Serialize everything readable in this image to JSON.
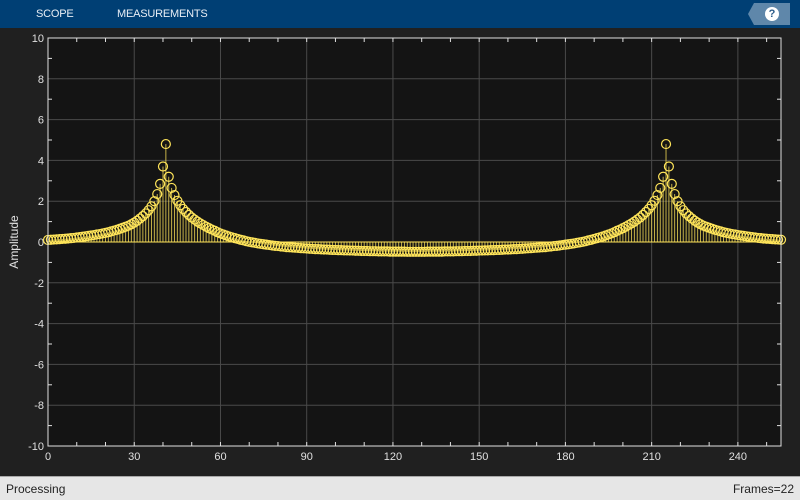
{
  "toolbar": {
    "tabs": [
      "SCOPE",
      "MEASUREMENTS"
    ],
    "help_label": "?"
  },
  "status": {
    "left": "Processing",
    "right": "Frames=22"
  },
  "colors": {
    "toolbar": "#003f74",
    "axes_bg": "#141414",
    "figure_bg": "#202020",
    "series": "#ffe55a",
    "grid": "#4a4a4a"
  },
  "chart_data": {
    "type": "stem",
    "title": "",
    "xlabel": "",
    "ylabel": "Amplitude",
    "xlim": [
      0,
      255
    ],
    "ylim": [
      -10,
      10
    ],
    "grid": true,
    "xticks": [
      0,
      30,
      60,
      90,
      120,
      150,
      180,
      210,
      240
    ],
    "yticks": [
      -10,
      -8,
      -6,
      -4,
      -2,
      0,
      2,
      4,
      6,
      8,
      10
    ],
    "x_start": 0,
    "x_step": 1,
    "values": [
      0.1,
      0.11,
      0.12,
      0.13,
      0.14,
      0.15,
      0.16,
      0.17,
      0.19,
      0.2,
      0.22,
      0.24,
      0.26,
      0.28,
      0.3,
      0.32,
      0.34,
      0.37,
      0.39,
      0.42,
      0.45,
      0.48,
      0.52,
      0.56,
      0.6,
      0.65,
      0.7,
      0.75,
      0.8,
      0.87,
      0.95,
      1.04,
      1.15,
      1.27,
      1.4,
      1.56,
      1.75,
      2.0,
      2.35,
      2.85,
      3.7,
      4.8,
      3.2,
      2.65,
      2.3,
      2.02,
      1.8,
      1.62,
      1.47,
      1.33,
      1.2,
      1.1,
      1.0,
      0.91,
      0.83,
      0.75,
      0.68,
      0.61,
      0.55,
      0.48,
      0.42,
      0.37,
      0.32,
      0.27,
      0.23,
      0.19,
      0.15,
      0.11,
      0.08,
      0.04,
      0.01,
      -0.02,
      -0.04,
      -0.07,
      -0.09,
      -0.11,
      -0.13,
      -0.15,
      -0.17,
      -0.19,
      -0.2,
      -0.22,
      -0.23,
      -0.25,
      -0.26,
      -0.27,
      -0.28,
      -0.29,
      -0.3,
      -0.31,
      -0.32,
      -0.33,
      -0.34,
      -0.35,
      -0.35,
      -0.36,
      -0.37,
      -0.37,
      -0.38,
      -0.39,
      -0.39,
      -0.4,
      -0.4,
      -0.41,
      -0.41,
      -0.42,
      -0.42,
      -0.43,
      -0.43,
      -0.44,
      -0.44,
      -0.44,
      -0.45,
      -0.45,
      -0.45,
      -0.46,
      -0.46,
      -0.46,
      -0.46,
      -0.47,
      -0.47,
      -0.47,
      -0.47,
      -0.47,
      -0.47,
      -0.48,
      -0.48,
      -0.48,
      -0.48,
      -0.48,
      -0.48,
      -0.48,
      -0.47,
      -0.47,
      -0.47,
      -0.47,
      -0.47,
      -0.47,
      -0.46,
      -0.46,
      -0.46,
      -0.46,
      -0.45,
      -0.45,
      -0.45,
      -0.44,
      -0.44,
      -0.44,
      -0.43,
      -0.43,
      -0.42,
      -0.42,
      -0.41,
      -0.41,
      -0.4,
      -0.4,
      -0.39,
      -0.39,
      -0.38,
      -0.37,
      -0.37,
      -0.36,
      -0.35,
      -0.35,
      -0.34,
      -0.33,
      -0.32,
      -0.31,
      -0.3,
      -0.29,
      -0.28,
      -0.27,
      -0.26,
      -0.25,
      -0.23,
      -0.22,
      -0.2,
      -0.19,
      -0.17,
      -0.15,
      -0.13,
      -0.11,
      -0.09,
      -0.07,
      -0.04,
      -0.02,
      0.01,
      0.04,
      0.08,
      0.11,
      0.15,
      0.19,
      0.23,
      0.27,
      0.32,
      0.37,
      0.42,
      0.48,
      0.55,
      0.61,
      0.68,
      0.75,
      0.83,
      0.91,
      1.0,
      1.1,
      1.2,
      1.33,
      1.47,
      1.62,
      1.8,
      2.02,
      2.3,
      2.65,
      3.2,
      4.8,
      3.7,
      2.85,
      2.35,
      2.0,
      1.75,
      1.56,
      1.4,
      1.27,
      1.15,
      1.04,
      0.95,
      0.87,
      0.8,
      0.75,
      0.7,
      0.65,
      0.6,
      0.56,
      0.52,
      0.48,
      0.45,
      0.42,
      0.39,
      0.37,
      0.34,
      0.32,
      0.3,
      0.28,
      0.26,
      0.24,
      0.22,
      0.2,
      0.19,
      0.17,
      0.16,
      0.15,
      0.14,
      0.13,
      0.12,
      0.11
    ]
  }
}
